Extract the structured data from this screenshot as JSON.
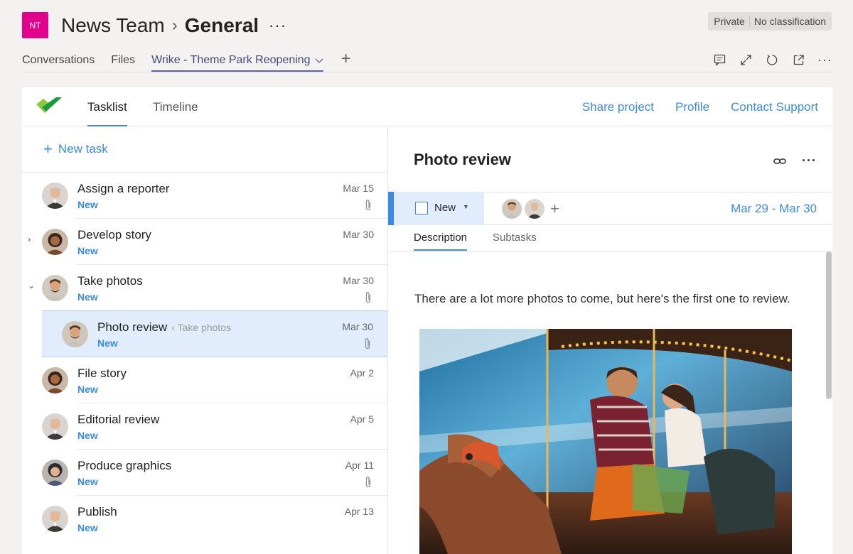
{
  "header": {
    "team_initials": "NT",
    "team_name": "News Team",
    "channel": "General",
    "more": "···",
    "privacy": "Private",
    "classification": "No classification"
  },
  "tabs": {
    "items": [
      "Conversations",
      "Files"
    ],
    "active": "Wrike - Theme Park Reopening",
    "add": "+"
  },
  "app": {
    "tabs": [
      "Tasklist",
      "Timeline"
    ],
    "links": [
      "Share project",
      "Profile",
      "Contact Support"
    ],
    "new_task": "New task"
  },
  "tasks": [
    {
      "name": "Assign a reporter",
      "status": "New",
      "date": "Mar 15",
      "attachment": true,
      "expand": ""
    },
    {
      "name": "Develop story",
      "status": "New",
      "date": "Mar 30",
      "attachment": false,
      "expand": "›"
    },
    {
      "name": "Take photos",
      "status": "New",
      "date": "Mar 30",
      "attachment": true,
      "expand": "⌄"
    },
    {
      "name": "Photo review",
      "parent": "Take photos",
      "status": "New",
      "date": "Mar 30",
      "attachment": true,
      "selected": true
    },
    {
      "name": "File story",
      "status": "New",
      "date": "Apr 2",
      "attachment": false
    },
    {
      "name": "Editorial review",
      "status": "New",
      "date": "Apr 5",
      "attachment": false
    },
    {
      "name": "Produce graphics",
      "status": "New",
      "date": "Apr 11",
      "attachment": true
    },
    {
      "name": "Publish",
      "status": "New",
      "date": "Apr 13",
      "attachment": false
    }
  ],
  "detail": {
    "title": "Photo review",
    "status": "New",
    "date_range": "Mar 29 - Mar 30",
    "subtabs": [
      "Description",
      "Subtasks"
    ],
    "description": "There are a lot more photos to come, but here's the first one to review."
  },
  "colors": {
    "accent": "#3b8be0",
    "teams_purple": "#6264a7",
    "team_avatar": "#e3008c",
    "selected_row": "#e1edfc"
  }
}
